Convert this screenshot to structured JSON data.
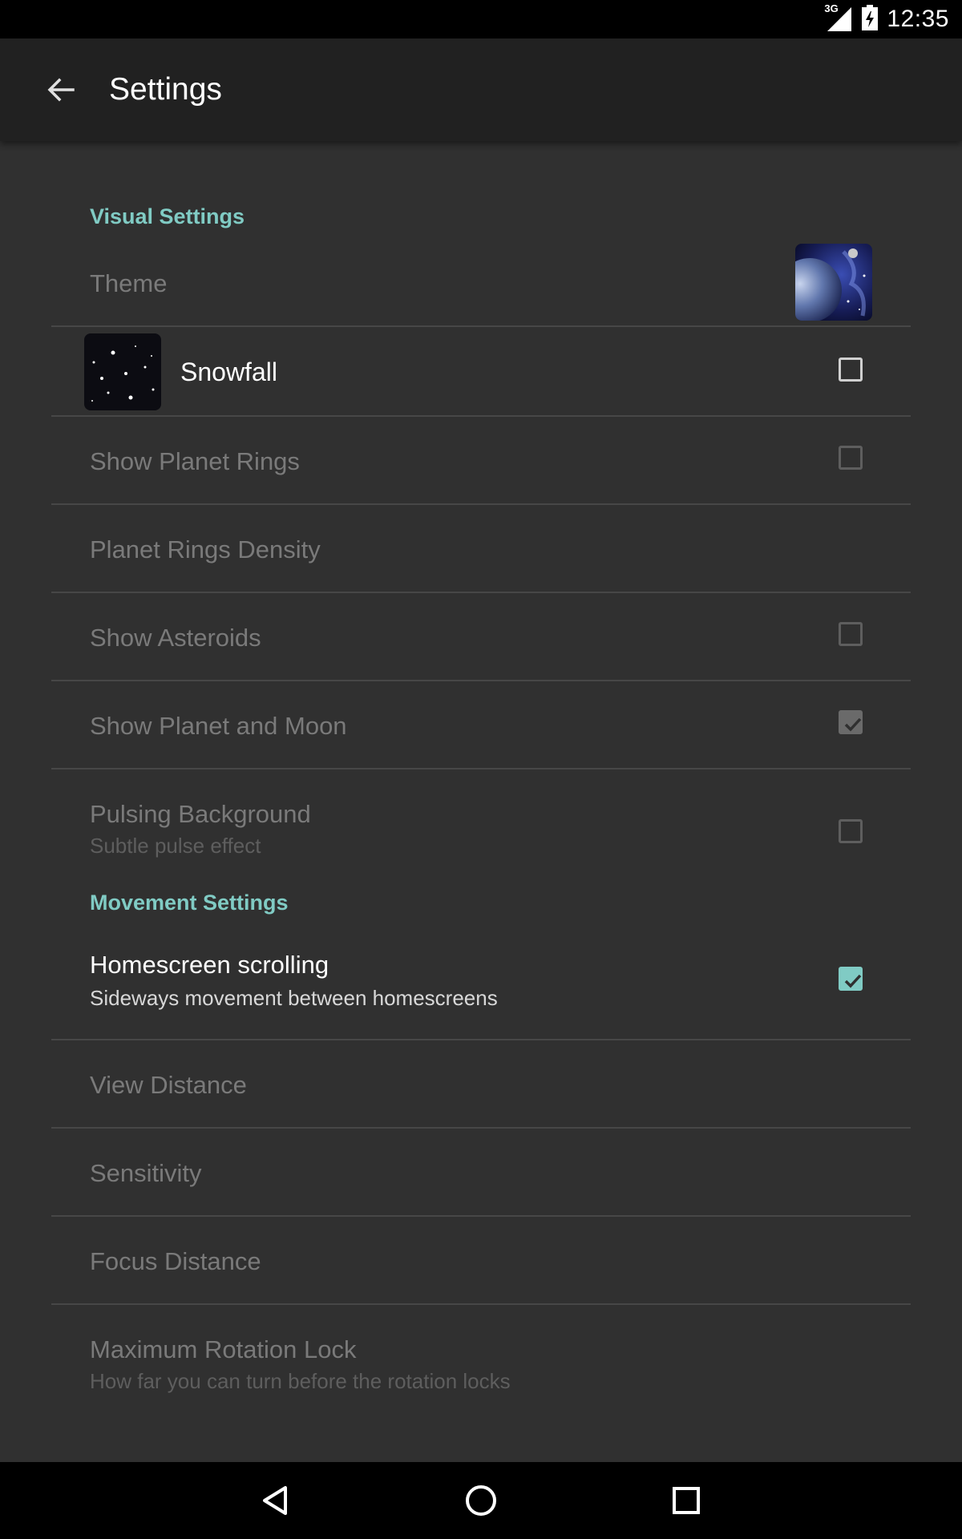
{
  "status_bar": {
    "network_type": "3G",
    "time": "12:35"
  },
  "app_bar": {
    "title": "Settings"
  },
  "sections": {
    "visual": {
      "header": "Visual Settings",
      "theme": {
        "title": "Theme"
      },
      "snowfall": {
        "title": "Snowfall",
        "checked": false
      },
      "planet_rings": {
        "title": "Show Planet Rings",
        "checked": false
      },
      "rings_density": {
        "title": "Planet Rings Density"
      },
      "asteroids": {
        "title": "Show Asteroids",
        "checked": false
      },
      "planet_moon": {
        "title": "Show Planet and Moon",
        "checked": true
      },
      "pulsing": {
        "title": "Pulsing Background",
        "summary": "Subtle pulse effect",
        "checked": false
      }
    },
    "movement": {
      "header": "Movement Settings",
      "scrolling": {
        "title": "Homescreen scrolling",
        "summary": "Sideways movement between homescreens",
        "checked": true
      },
      "view_distance": {
        "title": "View Distance"
      },
      "sensitivity": {
        "title": "Sensitivity"
      },
      "focus_distance": {
        "title": "Focus Distance"
      },
      "rotation_lock": {
        "title": "Maximum Rotation Lock",
        "summary": "How far you can turn before the rotation locks"
      }
    }
  },
  "colors": {
    "accent": "#80cbc4",
    "background": "#303030",
    "app_bar": "#212121"
  }
}
